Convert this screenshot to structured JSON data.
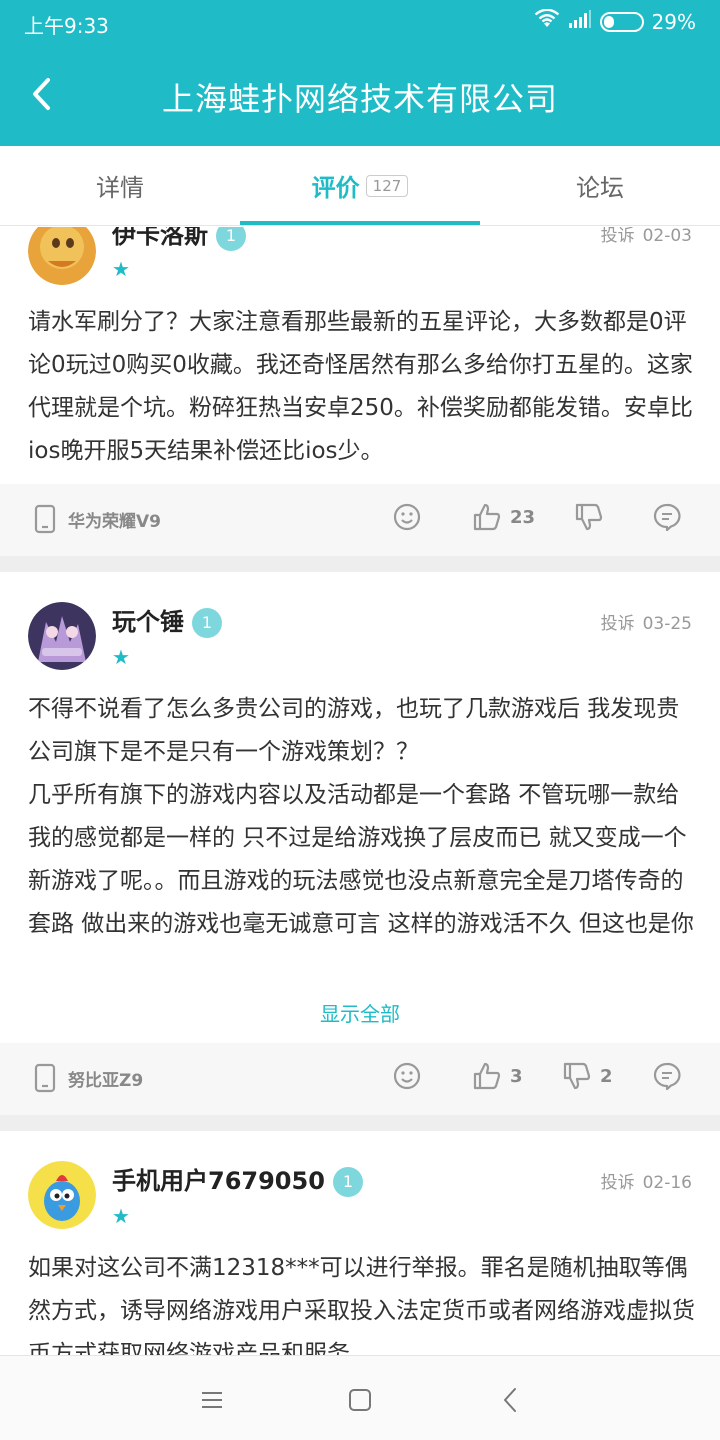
{
  "status": {
    "time": "上午9:33",
    "battery": "29%",
    "battery_level": 0.29
  },
  "header": {
    "title": "上海蛙扑网络技术有限公司"
  },
  "tabs": [
    {
      "label": "详情"
    },
    {
      "label": "评价",
      "count": "127"
    },
    {
      "label": "论坛"
    }
  ],
  "reviews": [
    {
      "user": "伊卡洛斯",
      "level": "1",
      "stars": "★",
      "report": "投诉",
      "date": "02-03",
      "content": "请水军刷分了？大家注意看那些最新的五星评论，大多数都是0评论0玩过0购买0收藏。我还奇怪居然有那么多给你打五星的。这家代理就是个坑。粉碎狂热当安卓250。补偿奖励都能发错。安卓比ios晚开服5天结果补偿还比ios少。",
      "device": "华为荣耀V9",
      "likes": "23",
      "dislikes": ""
    },
    {
      "user": "玩个锤",
      "level": "1",
      "stars": "★",
      "report": "投诉",
      "date": "03-25",
      "content_lines": [
        "不得不说看了怎么多贵公司的游戏，也玩了几款游戏后 我发现贵公司旗下是不是只有一个游戏策划？？",
        "几乎所有旗下的游戏内容以及活动都是一个套路 不管玩哪一款给我的感觉都是一样的 只不过是给游戏换了层皮而已 就又变成一个新游戏了呢。。而且游戏的玩法感觉也没点新意完全是刀塔传奇的套路 做出来的游戏也毫无诚意可言 这样的游戏活不久 但这也是你们的目的 这波操作真的很稳"
      ],
      "show_all": "显示全部",
      "device": "努比亚Z9",
      "likes": "3",
      "dislikes": "2"
    },
    {
      "user": "手机用户7679050",
      "level": "1",
      "stars": "★",
      "report": "投诉",
      "date": "02-16",
      "content": "如果对这公司不满12318***可以进行举报。罪名是随机抽取等偶然方式，诱导网络游戏用户采取投入法定货币或者网络游戏虚拟货币方式获取网络游戏产品和服务"
    }
  ]
}
